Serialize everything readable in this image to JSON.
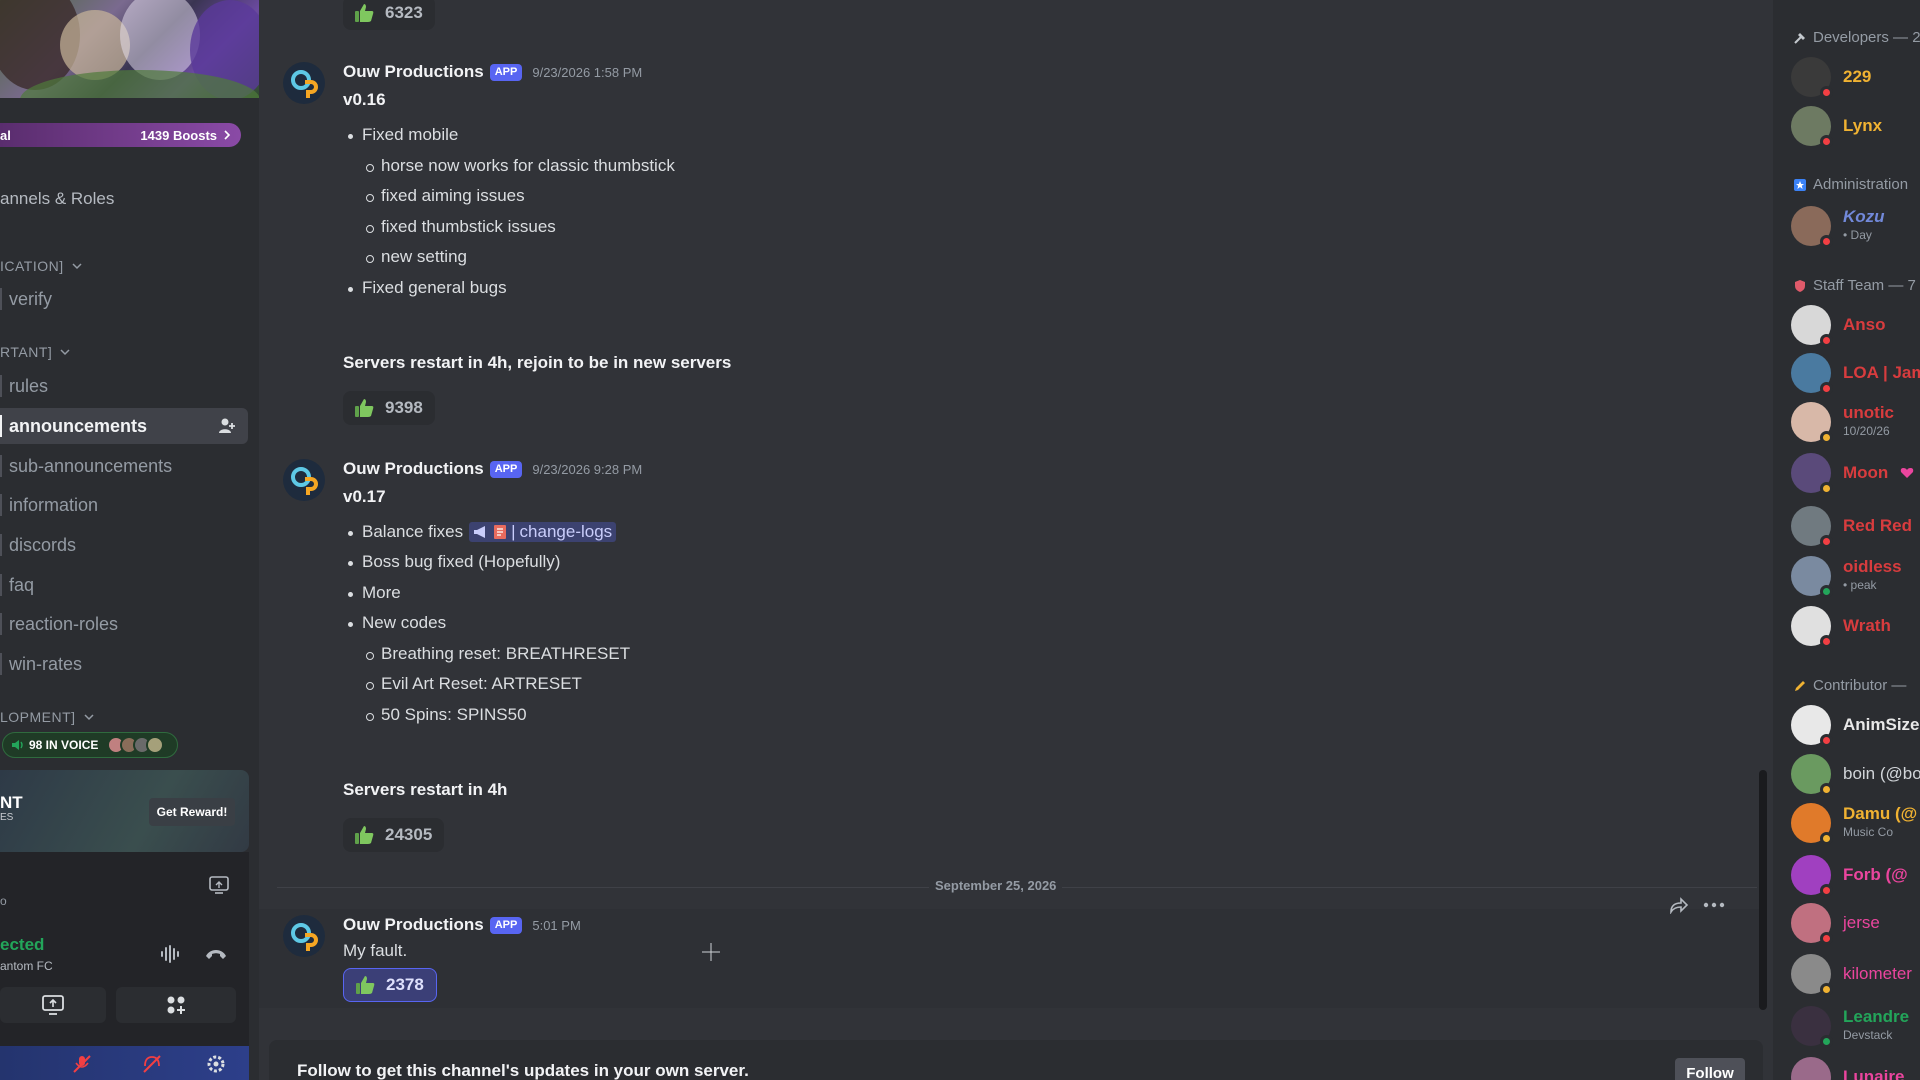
{
  "sidebar": {
    "boost": {
      "name": "al",
      "count": "1439 Boosts"
    },
    "channels_roles": "annels & Roles",
    "categories": [
      {
        "label": "ICATION]"
      },
      {
        "label": "RTANT]"
      },
      {
        "label": "LOPMENT]"
      }
    ],
    "channels": [
      {
        "label": "verify"
      },
      {
        "label": "rules"
      },
      {
        "label": "announcements"
      },
      {
        "label": "sub-announcements"
      },
      {
        "label": "information"
      },
      {
        "label": "discords"
      },
      {
        "label": "faq"
      },
      {
        "label": "reaction-roles"
      },
      {
        "label": "win-rates"
      }
    ],
    "voice": {
      "label": "98 IN VOICE"
    },
    "promo": {
      "title": "NT",
      "subtitle": "ES",
      "button": "Get Reward!"
    },
    "user": {
      "fragment": "o",
      "status": "ected",
      "server": "antom FC"
    }
  },
  "chat": {
    "top_reaction": "6323",
    "messages": [
      {
        "author": "Ouw Productions",
        "tag": "APP",
        "timestamp": "9/23/2026 1:58 PM",
        "version": "v0.16",
        "lines": [
          "Fixed mobile",
          "horse now works for classic thumbstick",
          "fixed aiming issues",
          "fixed thumbstick issues",
          "new setting",
          "Fixed general bugs"
        ],
        "footer": "Servers restart in 4h, rejoin to be in new servers",
        "reaction": "9398"
      },
      {
        "author": "Ouw Productions",
        "tag": "APP",
        "timestamp": "9/23/2026 9:28 PM",
        "version": "v0.17",
        "balance": "Balance fixes",
        "mention": "change-logs",
        "lines": [
          "Boss bug fixed (Hopefully)",
          "More",
          "New codes",
          "Breathing reset: BREATHRESET",
          "Evil Art Reset: ARTRESET",
          "50 Spins: SPINS50"
        ],
        "footer": "Servers restart in 4h",
        "reaction": "24305"
      },
      {
        "author": "Ouw Productions",
        "tag": "APP",
        "timestamp": "5:01 PM",
        "text": "My fault.",
        "reaction": "2378"
      }
    ],
    "date_divider": "September 25, 2026",
    "follow": {
      "text": "Follow to get this channel's updates in your own server.",
      "button": "Follow"
    }
  },
  "members": {
    "roles": [
      {
        "label": "Developers — 2"
      },
      {
        "label": "Administration"
      },
      {
        "label": "Staff Team — 7"
      },
      {
        "label": "Contributor —"
      }
    ],
    "list": [
      {
        "name": "229",
        "status_text": "",
        "color": "#f0b232"
      },
      {
        "name": "Lynx",
        "status_text": "",
        "color": "#f0b232"
      },
      {
        "name": "Kozu",
        "status_text": "• Day",
        "color": "#7289da"
      },
      {
        "name": "Anso",
        "status_text": "",
        "color": "#d83c3e"
      },
      {
        "name": "LOA | Jam",
        "status_text": "",
        "color": "#d83c3e"
      },
      {
        "name": "unotic",
        "status_text": "10/20/26",
        "color": "#d83c3e"
      },
      {
        "name": "Moon",
        "status_text": "",
        "color": "#d83c3e"
      },
      {
        "name": "Red Red",
        "status_text": "",
        "color": "#d83c3e"
      },
      {
        "name": "oidless",
        "status_text": "• peak",
        "color": "#d83c3e"
      },
      {
        "name": "Wrath",
        "status_text": "",
        "color": "#d83c3e"
      },
      {
        "name": "AnimSize",
        "status_text": "",
        "color": "#e8e8e8"
      },
      {
        "name": "boin (@bo",
        "status_text": "",
        "color": "#d1d5d9"
      },
      {
        "name": "Damu (@",
        "status_text": "Music Co",
        "color": "#f0b232"
      },
      {
        "name": "Forb (@",
        "status_text": "",
        "color": "#eb459e"
      },
      {
        "name": "jerse",
        "status_text": "",
        "color": "#eb459e"
      },
      {
        "name": "kilometer",
        "status_text": "",
        "color": "#eb459e"
      },
      {
        "name": "Leandre",
        "status_text": "Devstack",
        "color": "#23a55a"
      },
      {
        "name": "Lunaire",
        "status_text": "",
        "color": "#eb459e"
      }
    ]
  }
}
